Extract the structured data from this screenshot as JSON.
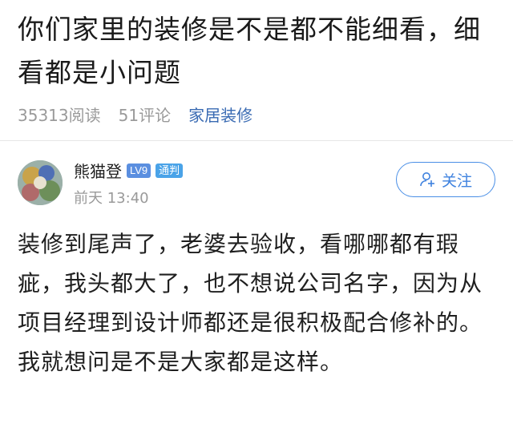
{
  "article": {
    "title": "你们家里的装修是不是都不能细看，细看都是小问题",
    "reads": "35313阅读",
    "comments": "51评论",
    "category": "家居装修"
  },
  "author": {
    "name": "熊猫登",
    "level_badge": "LV9",
    "role_badge": "通判",
    "time": "前天 13:40",
    "follow_label": "关注",
    "follow_icon": "add-user-icon",
    "accent_color": "#3f82df"
  },
  "post": {
    "body": "装修到尾声了，老婆去验收，看哪哪都有瑕疵，我头都大了，也不想说公司名字，因为从项目经理到设计师都还是很积极配合修补的。我就想问是不是大家都是这样。"
  }
}
